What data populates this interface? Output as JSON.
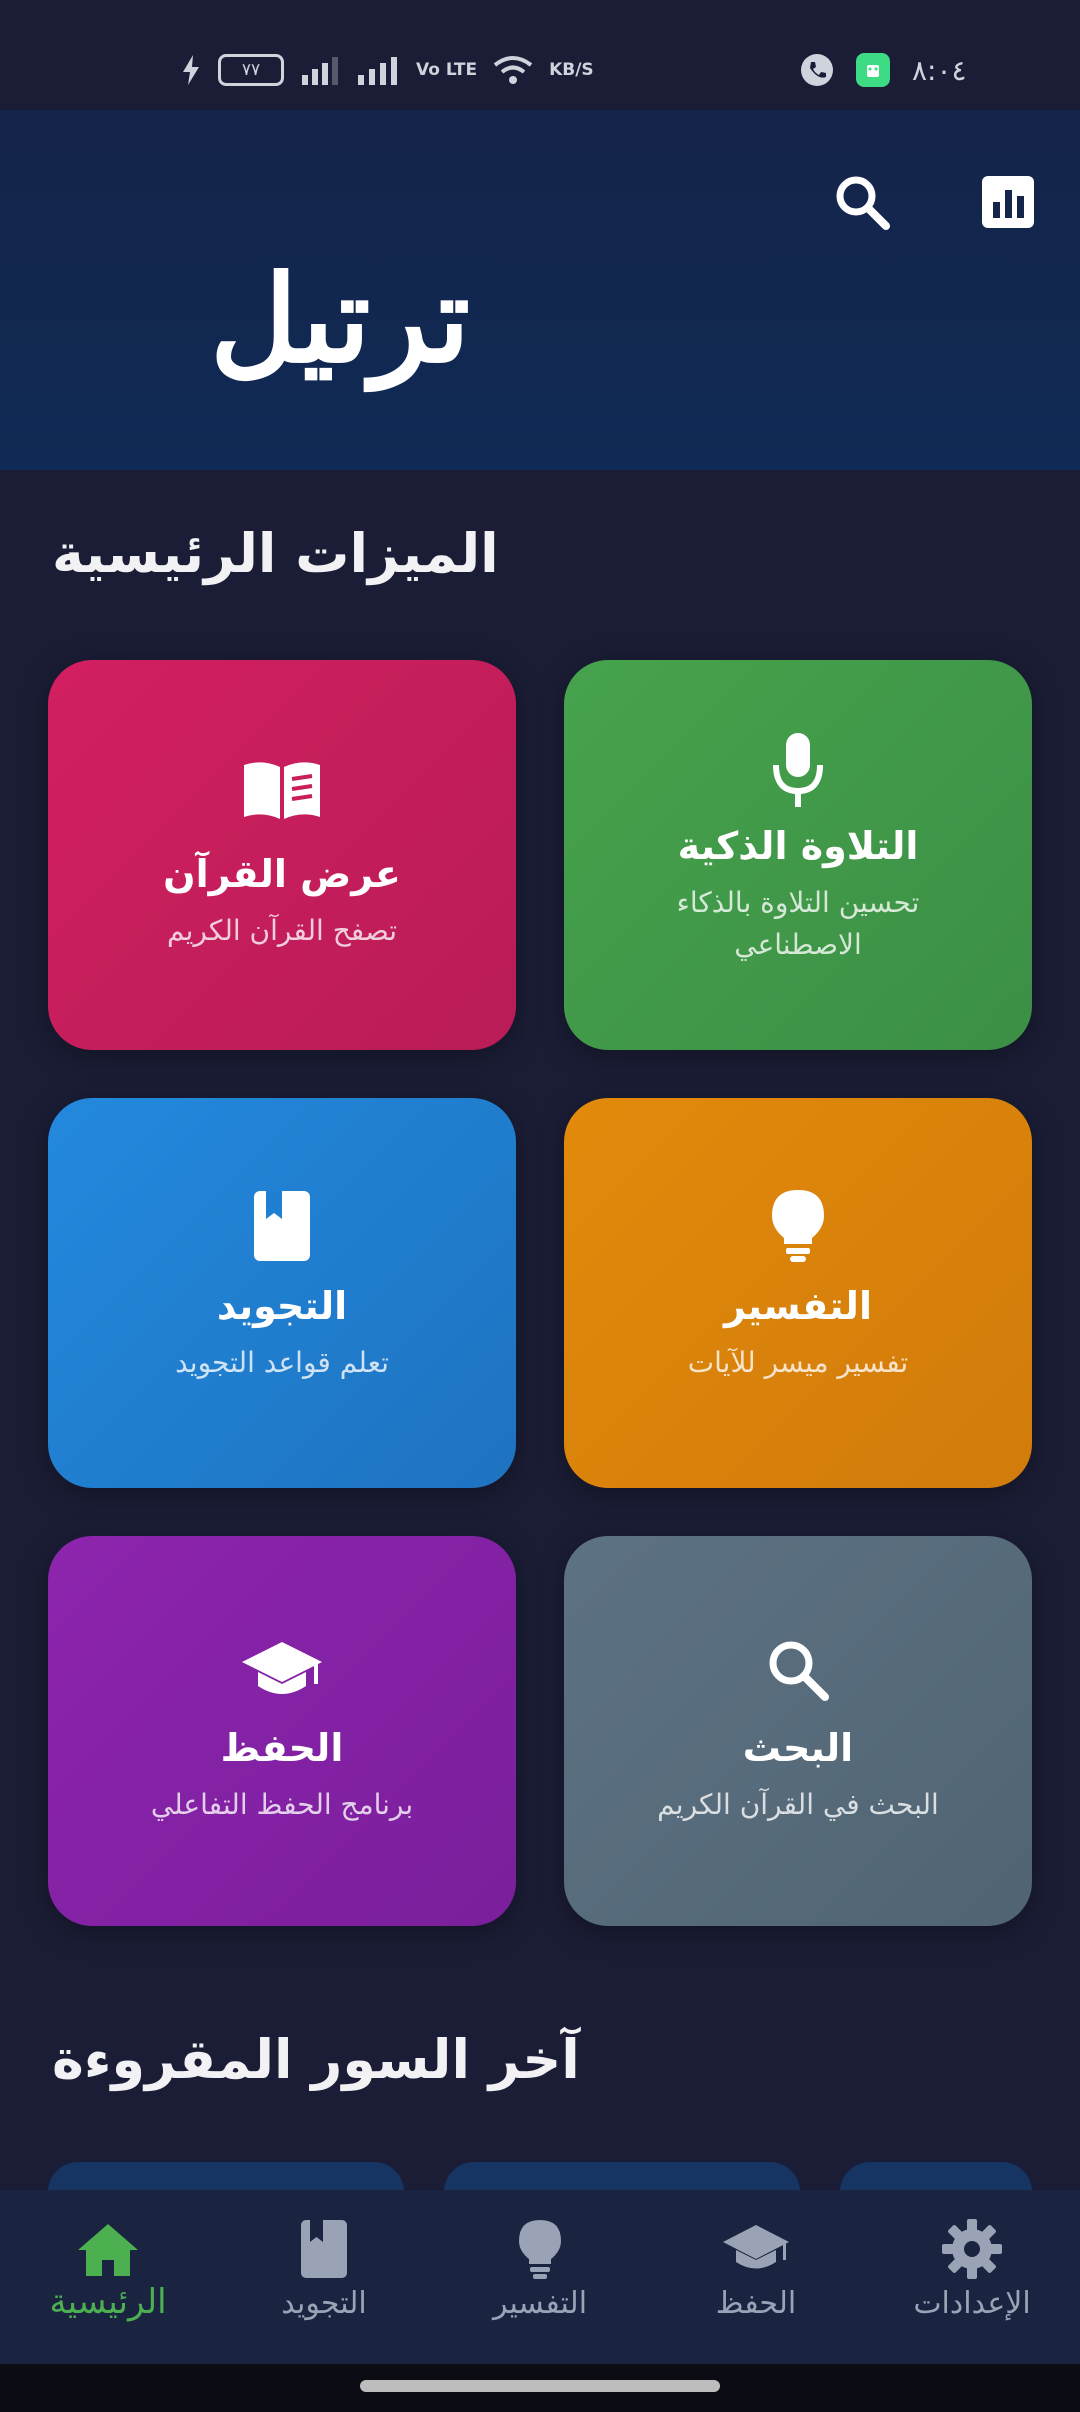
{
  "status_bar": {
    "time": "٨:٠٤",
    "battery": "٧٧",
    "network_label": "Vo LTE",
    "speed_unit": "KB/S"
  },
  "header": {
    "title": "ترتيل"
  },
  "features": {
    "title": "الميزات الرئيسية",
    "items": [
      {
        "title": "عرض القرآن",
        "subtitle": "تصفح القرآن الكريم",
        "icon": "book-open-icon",
        "color": "#c91e5a"
      },
      {
        "title": "التلاوة الذكية",
        "subtitle": "تحسين التلاوة بالذكاء الاصطناعي",
        "icon": "microphone-icon",
        "color": "#43a047"
      },
      {
        "title": "التجويد",
        "subtitle": "تعلم قواعد التجويد",
        "icon": "book-bookmark-icon",
        "color": "#1e7fd3"
      },
      {
        "title": "التفسير",
        "subtitle": "تفسير ميسر للآيات",
        "icon": "lightbulb-icon",
        "color": "#dd830b"
      },
      {
        "title": "الحفظ",
        "subtitle": "برنامج الحفظ التفاعلي",
        "icon": "graduation-cap-icon",
        "color": "#8422a5"
      },
      {
        "title": "البحث",
        "subtitle": "البحث في القرآن الكريم",
        "icon": "search-icon",
        "color": "#576b7b"
      }
    ]
  },
  "recent": {
    "title": "آخر السور المقروءة"
  },
  "bottom_nav": {
    "items": [
      {
        "label": "الرئيسية",
        "icon": "home-icon",
        "active": true
      },
      {
        "label": "التجويد",
        "icon": "book-bookmark-icon",
        "active": false
      },
      {
        "label": "التفسير",
        "icon": "lightbulb-icon",
        "active": false
      },
      {
        "label": "الحفظ",
        "icon": "graduation-cap-icon",
        "active": false
      },
      {
        "label": "الإعدادات",
        "icon": "gear-icon",
        "active": false
      }
    ],
    "active_color": "#4caf50",
    "inactive_color": "#9aa3b5"
  }
}
